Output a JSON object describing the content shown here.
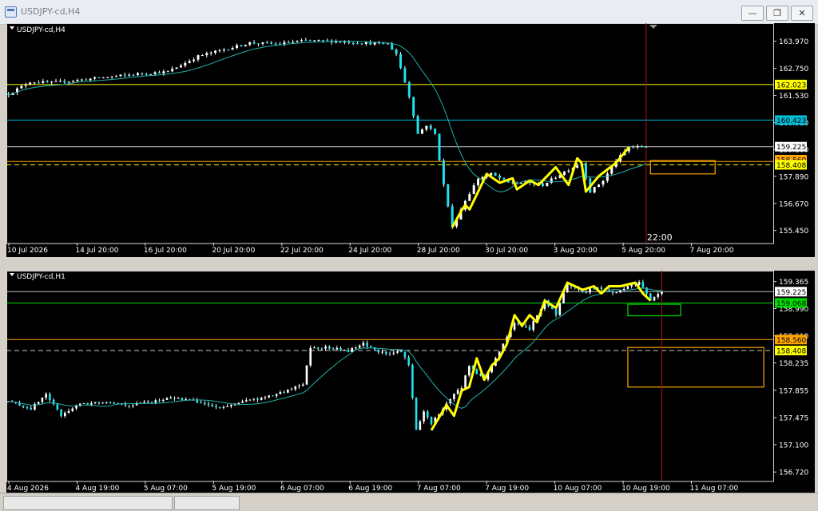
{
  "window": {
    "title": "USDJPY-cd,H4",
    "minimize_label": "—",
    "maximize_label": "❐",
    "close_label": "✕"
  },
  "chart_data": [
    {
      "type": "candlestick",
      "title": "USDJPY-cd,H4",
      "ylim": [
        154.9,
        164.5
      ],
      "y_ticks": [
        "163.970",
        "162.750",
        "161.530",
        "160.310",
        "159.100",
        "157.890",
        "156.670",
        "155.450"
      ],
      "x_ticks": [
        "10 Jul 2026",
        "14 Jul 20:00",
        "16 Jul 20:00",
        "20 Jul 20:00",
        "22 Jul 20:00",
        "24 Jul 20:00",
        "28 Jul 20:00",
        "30 Jul 20:00",
        "3 Aug 20:00",
        "5 Aug 20:00",
        "7 Aug 20:00"
      ],
      "price_labels": [
        {
          "text": "162.023",
          "value": 162.023,
          "bg": "#ffff00",
          "fg": "#000000"
        },
        {
          "text": "160.423",
          "value": 160.423,
          "bg": "#00bcd4",
          "fg": "#000000"
        },
        {
          "text": "159.225",
          "value": 159.225,
          "bg": "#ffffff",
          "fg": "#000000"
        },
        {
          "text": "158.560",
          "value": 158.64,
          "bg": "#ffa500",
          "fg": "#000000"
        },
        {
          "text": "158.408",
          "value": 158.408,
          "bg": "#ffff00",
          "fg": "#000000"
        }
      ],
      "levels": [
        {
          "value": 162.023,
          "color": "#ffff00",
          "style": "solid"
        },
        {
          "value": 160.423,
          "color": "#00bcd4",
          "style": "solid"
        },
        {
          "value": 159.225,
          "color": "#c0c0c0",
          "style": "solid"
        },
        {
          "value": 158.56,
          "color": "#ffa500",
          "style": "solid"
        },
        {
          "value": 158.408,
          "color": "#ffff00",
          "style": "dash"
        }
      ],
      "time_label": "22:00",
      "boxes": [
        {
          "t0": 193,
          "t1": 227,
          "y0": 162.1,
          "y1": 162.95,
          "color": "#ffff00"
        },
        {
          "t0": 149,
          "t1": 164,
          "y0": 158.0,
          "y1": 158.6,
          "color": "#ffa500"
        }
      ],
      "vline_t": 148,
      "anchors": [
        [
          0,
          161.6
        ],
        [
          5,
          162.15
        ],
        [
          10,
          162.1
        ],
        [
          20,
          162.3
        ],
        [
          30,
          162.5
        ],
        [
          37,
          162.6
        ],
        [
          44,
          163.3
        ],
        [
          50,
          163.6
        ],
        [
          56,
          163.9
        ],
        [
          62,
          163.85
        ],
        [
          69,
          164.0
        ],
        [
          74,
          163.98
        ],
        [
          82,
          163.9
        ],
        [
          88,
          163.85
        ],
        [
          90,
          163.4
        ],
        [
          93,
          161.5
        ],
        [
          95,
          159.8
        ],
        [
          97,
          160.2
        ],
        [
          99,
          159.8
        ],
        [
          101,
          157.5
        ],
        [
          103,
          155.6
        ],
        [
          106,
          156.8
        ],
        [
          109,
          157.8
        ],
        [
          112,
          158.0
        ],
        [
          116,
          157.6
        ],
        [
          120,
          157.6
        ],
        [
          124,
          157.5
        ],
        [
          129,
          158.1
        ],
        [
          133,
          158.5
        ],
        [
          135,
          157.2
        ],
        [
          138,
          157.7
        ],
        [
          141,
          158.6
        ],
        [
          144,
          159.2
        ],
        [
          148,
          159.225
        ]
      ],
      "zigzag": [
        [
          103,
          155.6
        ],
        [
          105,
          156.3
        ],
        [
          106,
          156.6
        ],
        [
          107,
          156.4
        ],
        [
          109,
          157.2
        ],
        [
          111,
          158.0
        ],
        [
          114,
          157.6
        ],
        [
          117,
          157.8
        ],
        [
          118,
          157.3
        ],
        [
          121,
          157.7
        ],
        [
          123,
          157.5
        ],
        [
          127,
          158.3
        ],
        [
          130,
          157.5
        ],
        [
          132,
          158.7
        ],
        [
          133,
          158.5
        ],
        [
          134,
          157.2
        ],
        [
          137,
          157.9
        ],
        [
          141,
          158.5
        ],
        [
          144,
          159.2
        ]
      ]
    },
    {
      "type": "candlestick",
      "title": "USDJPY-cd,H1",
      "ylim": [
        156.6,
        159.45
      ],
      "y_ticks": [
        "159.365",
        "158.990",
        "158.610",
        "158.235",
        "157.855",
        "157.475",
        "157.100",
        "156.720"
      ],
      "x_ticks": [
        "4 Aug 2026",
        "4 Aug 19:00",
        "5 Aug 07:00",
        "5 Aug 19:00",
        "6 Aug 07:00",
        "6 Aug 19:00",
        "7 Aug 07:00",
        "7 Aug 19:00",
        "10 Aug 07:00",
        "10 Aug 19:00",
        "11 Aug 07:00"
      ],
      "price_labels": [
        {
          "text": "159.225",
          "value": 159.225,
          "bg": "#ffffff",
          "fg": "#000000"
        },
        {
          "text": "159.068",
          "value": 159.068,
          "bg": "#00e000",
          "fg": "#000000"
        },
        {
          "text": "158.560",
          "value": 158.56,
          "bg": "#ffa500",
          "fg": "#000000"
        },
        {
          "text": "158.408",
          "value": 158.408,
          "bg": "#ffff00",
          "fg": "#000000"
        }
      ],
      "levels": [
        {
          "value": 159.225,
          "color": "#c0c0c0",
          "style": "solid"
        },
        {
          "value": 159.068,
          "color": "#00e000",
          "style": "solid"
        },
        {
          "value": 158.56,
          "color": "#ffa500",
          "style": "solid"
        },
        {
          "value": 158.408,
          "color": "#c8c8c8",
          "style": "dash"
        }
      ],
      "boxes": [
        {
          "t0": 164,
          "t1": 178,
          "y0": 158.89,
          "y1": 159.05,
          "color": "#00e000"
        },
        {
          "t0": 164,
          "t1": 200,
          "y0": 157.9,
          "y1": 158.45,
          "color": "#ffa500"
        }
      ],
      "vline_t": 173,
      "anchors": [
        [
          0,
          157.7
        ],
        [
          6,
          157.6
        ],
        [
          10,
          157.8
        ],
        [
          14,
          157.5
        ],
        [
          18,
          157.65
        ],
        [
          26,
          157.7
        ],
        [
          32,
          157.65
        ],
        [
          38,
          157.7
        ],
        [
          44,
          157.75
        ],
        [
          50,
          157.7
        ],
        [
          56,
          157.6
        ],
        [
          62,
          157.7
        ],
        [
          68,
          157.75
        ],
        [
          74,
          157.85
        ],
        [
          78,
          157.95
        ],
        [
          80,
          158.45
        ],
        [
          84,
          158.45
        ],
        [
          90,
          158.4
        ],
        [
          94,
          158.5
        ],
        [
          100,
          158.35
        ],
        [
          104,
          158.4
        ],
        [
          106,
          158.2
        ],
        [
          108,
          157.3
        ],
        [
          110,
          157.55
        ],
        [
          112,
          157.4
        ],
        [
          115,
          157.6
        ],
        [
          118,
          157.8
        ],
        [
          120,
          157.9
        ],
        [
          122,
          158.2
        ],
        [
          126,
          158.0
        ],
        [
          130,
          158.4
        ],
        [
          134,
          158.8
        ],
        [
          138,
          158.7
        ],
        [
          142,
          159.1
        ],
        [
          145,
          158.9
        ],
        [
          148,
          159.35
        ],
        [
          152,
          159.2
        ],
        [
          156,
          159.3
        ],
        [
          160,
          159.2
        ],
        [
          164,
          159.3
        ],
        [
          167,
          159.35
        ],
        [
          170,
          159.1
        ],
        [
          173,
          159.225
        ]
      ],
      "zigzag": [
        [
          112,
          157.3
        ],
        [
          116,
          157.65
        ],
        [
          118,
          157.5
        ],
        [
          120,
          157.85
        ],
        [
          122,
          157.9
        ],
        [
          124,
          158.3
        ],
        [
          126,
          158.0
        ],
        [
          128,
          158.2
        ],
        [
          130,
          158.3
        ],
        [
          132,
          158.5
        ],
        [
          134,
          158.9
        ],
        [
          136,
          158.75
        ],
        [
          138,
          158.9
        ],
        [
          140,
          158.8
        ],
        [
          142,
          159.1
        ],
        [
          145,
          159.0
        ],
        [
          148,
          159.35
        ],
        [
          152,
          159.25
        ],
        [
          155,
          159.3
        ],
        [
          157,
          159.2
        ],
        [
          159,
          159.3
        ],
        [
          162,
          159.3
        ],
        [
          166,
          159.35
        ],
        [
          168,
          159.2
        ],
        [
          170,
          159.1
        ]
      ]
    }
  ]
}
